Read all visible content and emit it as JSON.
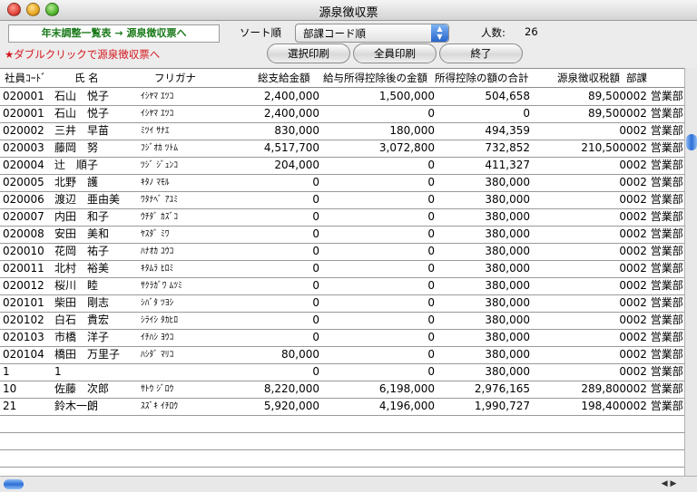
{
  "window": {
    "title": "源泉徴収票"
  },
  "nav": {
    "label": "年末調整一覧表 → 源泉徴収票へ"
  },
  "hint": "★ダブルクリックで源泉徴収票へ",
  "sort": {
    "label": "ソート順",
    "value": "部課コード順"
  },
  "count": {
    "label": "人数:",
    "value": "26"
  },
  "buttons": {
    "select_print": "選択印刷",
    "all_print": "全員印刷",
    "exit": "終了"
  },
  "table": {
    "headers": [
      "社員ｺｰﾄﾞ",
      "氏 名",
      "フリガナ",
      "総支給金額",
      "給与所得控除後の金額",
      "所得控除の額の合計",
      "源泉徴収税額",
      "部課"
    ],
    "rows": [
      [
        "020001",
        "石山　悦子",
        "ｲｼﾔﾏ ｴﾂｺ",
        "2,400,000",
        "1,500,000",
        "504,658",
        "89,500",
        "002 営業部"
      ],
      [
        "020001",
        "石山　悦子",
        "ｲｼﾔﾏ ｴﾂｺ",
        "2,400,000",
        "0",
        "0",
        "89,500",
        "002 営業部"
      ],
      [
        "020002",
        "三井　早苗",
        "ﾐﾂｲ ｻﾅｴ",
        "830,000",
        "180,000",
        "494,359",
        "0",
        "002 営業部"
      ],
      [
        "020003",
        "藤岡　努",
        "ﾌｼﾞｵｶ ﾂﾄﾑ",
        "4,517,700",
        "3,072,800",
        "732,852",
        "210,500",
        "002 営業部"
      ],
      [
        "020004",
        "辻　順子",
        "ﾂｼﾞ ｼﾞｭﾝｺ",
        "204,000",
        "0",
        "411,327",
        "0",
        "002 営業部"
      ],
      [
        "020005",
        "北野　護",
        "ｷﾀﾉ ﾏﾓﾙ",
        "0",
        "0",
        "380,000",
        "0",
        "002 営業部"
      ],
      [
        "020006",
        "渡辺　亜由美",
        "ﾜﾀﾅﾍﾞ ｱﾕﾐ",
        "0",
        "0",
        "380,000",
        "0",
        "002 営業部"
      ],
      [
        "020007",
        "内田　和子",
        "ｳﾁﾀﾞ ｶｽﾞｺ",
        "0",
        "0",
        "380,000",
        "0",
        "002 営業部"
      ],
      [
        "020008",
        "安田　美和",
        "ﾔｽﾀﾞ ﾐﾜ",
        "0",
        "0",
        "380,000",
        "0",
        "002 営業部"
      ],
      [
        "020010",
        "花岡　祐子",
        "ﾊﾅｵｶ ﾕｳｺ",
        "0",
        "0",
        "380,000",
        "0",
        "002 営業部"
      ],
      [
        "020011",
        "北村　裕美",
        "ｷﾀﾑﾗ ﾋﾛﾐ",
        "0",
        "0",
        "380,000",
        "0",
        "002 営業部"
      ],
      [
        "020012",
        "桜川　睦",
        "ｻｸﾗｶﾞﾜ ﾑﾂﾐ",
        "0",
        "0",
        "380,000",
        "0",
        "002 営業部"
      ],
      [
        "020101",
        "柴田　剛志",
        "ｼﾊﾞﾀ ﾂﾖｼ",
        "0",
        "0",
        "380,000",
        "0",
        "002 営業部"
      ],
      [
        "020102",
        "白石　貴宏",
        "ｼﾗｲｼ ﾀｶﾋﾛ",
        "0",
        "0",
        "380,000",
        "0",
        "002 営業部"
      ],
      [
        "020103",
        "市橋　洋子",
        "ｲﾁﾊｼ ﾖｳｺ",
        "0",
        "0",
        "380,000",
        "0",
        "002 営業部"
      ],
      [
        "020104",
        "橋田　万里子",
        "ﾊｼﾀﾞ ﾏﾘｺ",
        "80,000",
        "0",
        "380,000",
        "0",
        "002 営業部"
      ],
      [
        "1",
        "1",
        "",
        "0",
        "0",
        "380,000",
        "0",
        "002 営業部"
      ],
      [
        "10",
        "佐藤　次郎",
        "ｻﾄｳ ｼﾞﾛｳ",
        "8,220,000",
        "6,198,000",
        "2,976,165",
        "289,800",
        "002 営業部"
      ],
      [
        "21",
        "鈴木一朗",
        "ｽｽﾞｷ ｲﾁﾛｳ",
        "5,920,000",
        "4,196,000",
        "1,990,727",
        "198,400",
        "002 営業部"
      ]
    ]
  },
  "icons": {
    "close": "close-button-icon",
    "minimize": "minimize-button-icon",
    "zoom": "zoom-button-icon",
    "sort_arrow": "up-down-arrows-icon"
  }
}
